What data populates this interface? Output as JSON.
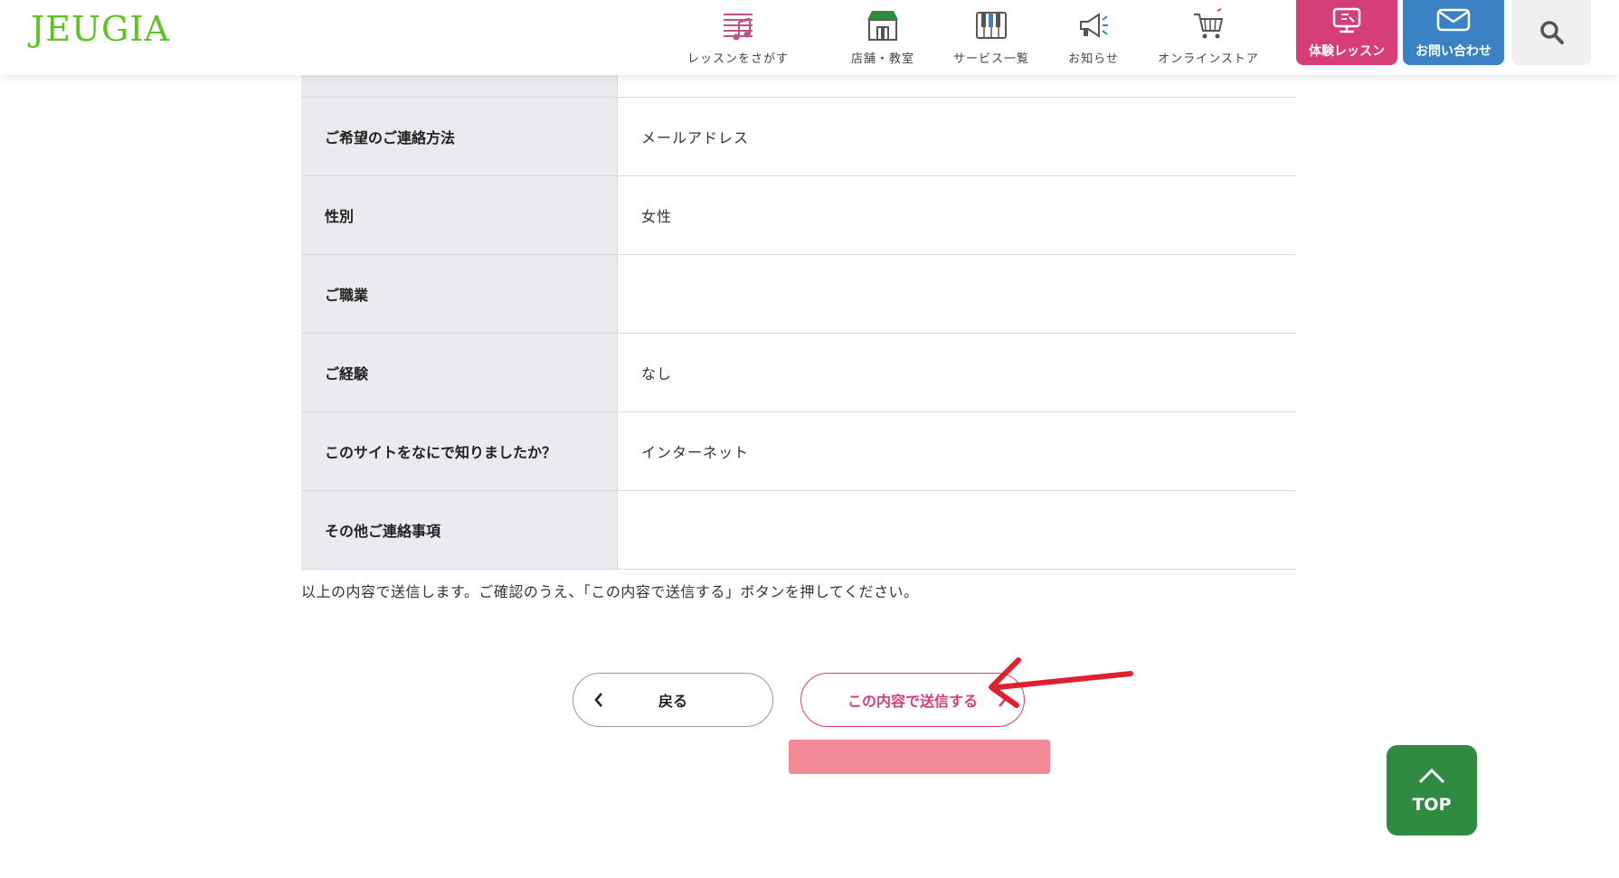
{
  "brand": {
    "logo_text": "JEUGIA",
    "logo_color": "#5cc41e"
  },
  "nav": [
    {
      "id": "lesson",
      "label": "レッスンをさがす",
      "icon": "music-score-icon"
    },
    {
      "id": "store",
      "label": "店舗・教室",
      "icon": "storefront-icon"
    },
    {
      "id": "services",
      "label": "サービス一覧",
      "icon": "piano-keys-icon"
    },
    {
      "id": "news",
      "label": "お知らせ",
      "icon": "megaphone-icon"
    },
    {
      "id": "store_online",
      "label": "オンラインストア",
      "icon": "shopping-cart-icon"
    }
  ],
  "cta": {
    "trial": {
      "label": "体験レッスン",
      "icon": "monitor-icon",
      "color": "#d63f75"
    },
    "contact": {
      "label": "お問い合わせ",
      "icon": "envelope-icon",
      "color": "#3b82c4"
    },
    "search_icon": "search-icon"
  },
  "table": {
    "rows": [
      {
        "label": "ご希望のご連絡方法",
        "value": "メールアドレス"
      },
      {
        "label": "性別",
        "value": "女性"
      },
      {
        "label": "ご職業",
        "value": ""
      },
      {
        "label": "ご経験",
        "value": "なし"
      },
      {
        "label": "このサイトをなにで知りましたか？",
        "value": "インターネット"
      },
      {
        "label": "その他ご連絡事項",
        "value": ""
      }
    ]
  },
  "note": "以上の内容で送信します。ご確認のうえ、「この内容で送信する」ボタンを押してください。",
  "buttons": {
    "back_label": "戻る",
    "submit_label": "この内容で送信する"
  },
  "top_button": {
    "label": "TOP",
    "color": "#2e8b40"
  },
  "annotation_colors": {
    "arrow": "#e02030",
    "highlight": "#f28b97"
  }
}
